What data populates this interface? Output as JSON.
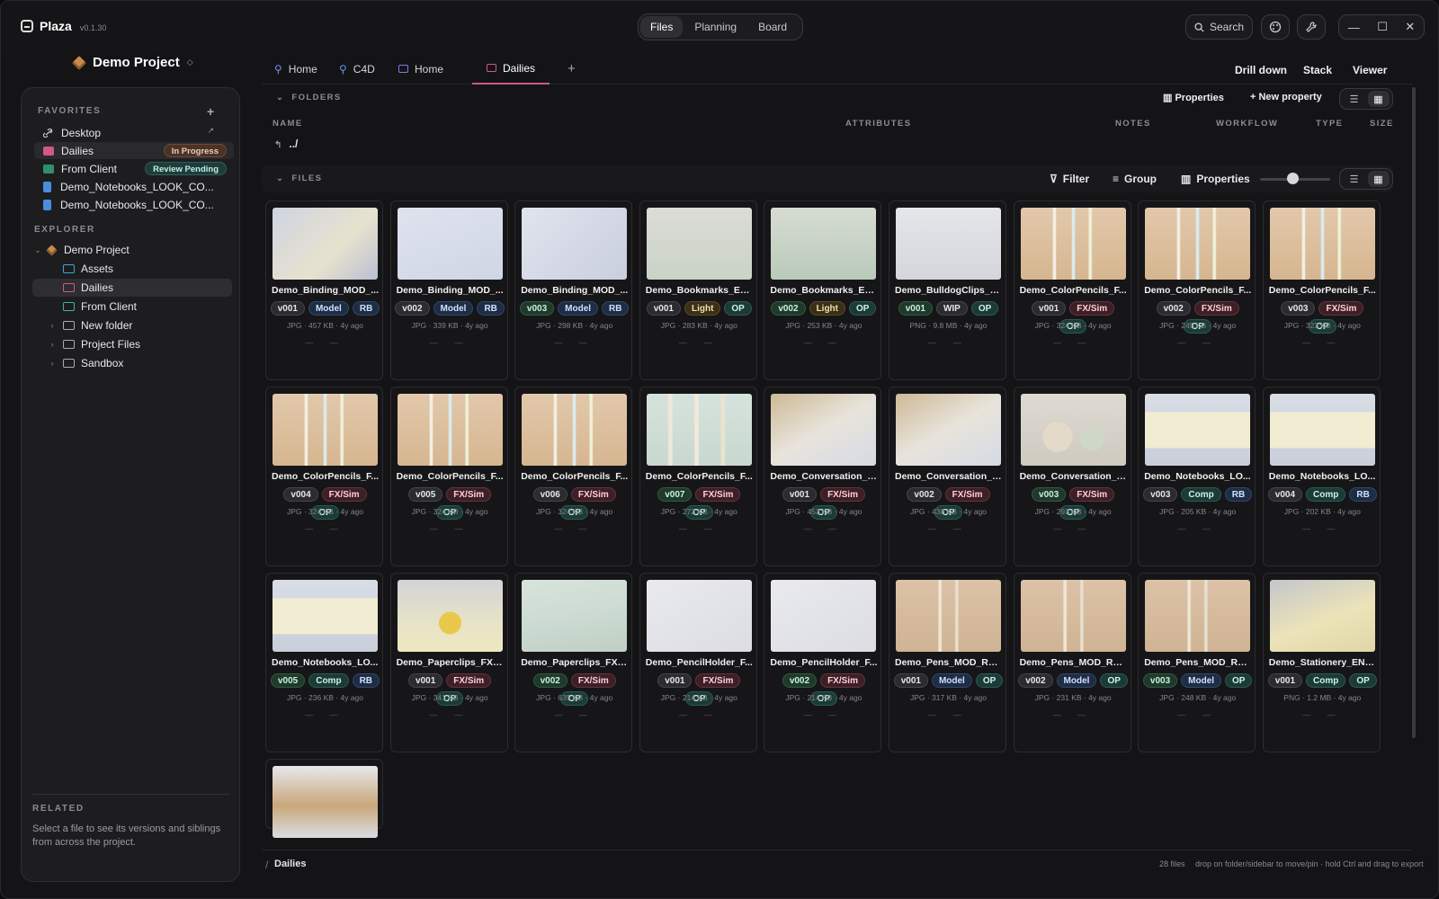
{
  "app": {
    "name": "Plaza",
    "version": "v0.1.30"
  },
  "top_nav": [
    "Files",
    "Planning",
    "Board"
  ],
  "top_nav_active": 0,
  "search_label": "Search",
  "window_controls": [
    "—",
    "☐",
    "✕"
  ],
  "project": {
    "title": "Demo Project",
    "caret": "◇"
  },
  "favorites": {
    "header": "FAVORITES",
    "add": "+",
    "items": [
      {
        "label": "Desktop",
        "badge": "",
        "link_arrow": "↗"
      },
      {
        "label": "Dailies",
        "badge": "In Progress"
      },
      {
        "label": "From Client",
        "badge": "Review Pending"
      },
      {
        "label": "Demo_Notebooks_LOOK_CO...",
        "badge": ""
      },
      {
        "label": "Demo_Notebooks_LOOK_CO...",
        "badge": ""
      }
    ]
  },
  "explorer": {
    "header": "EXPLORER",
    "items": [
      {
        "label": "Demo Project"
      },
      {
        "label": "Assets"
      },
      {
        "label": "Dailies"
      },
      {
        "label": "From Client"
      },
      {
        "label": "New folder"
      },
      {
        "label": "Project Files"
      },
      {
        "label": "Sandbox"
      }
    ]
  },
  "related": {
    "header": "RELATED",
    "text": "Select a file to see its versions and siblings from across the project."
  },
  "tabs": [
    {
      "label": "Home"
    },
    {
      "label": "C4D"
    },
    {
      "label": "Home"
    },
    {
      "label": "Dailies"
    }
  ],
  "tab_add": "+",
  "right_tools": [
    "Drill down",
    "Stack",
    "Viewer"
  ],
  "folders": {
    "header": "FOLDERS",
    "properties": "Properties",
    "new_property": "+ New property",
    "columns": [
      "NAME",
      "ATTRIBUTES",
      "NOTES",
      "WORKFLOW",
      "TYPE",
      "SIZE"
    ],
    "parent": "../"
  },
  "files": {
    "header": "FILES",
    "filter": "Filter",
    "group": "Group",
    "properties": "Properties"
  },
  "cards": [
    {
      "name": "Demo_Binding_MOD_...",
      "tags": [
        [
          "v001",
          "gray"
        ],
        [
          "Model",
          "blue"
        ],
        [
          "RB",
          "blue"
        ]
      ],
      "meta": "JPG · 457 KB · 4y ago",
      "dash": "— —"
    },
    {
      "name": "Demo_Binding_MOD_...",
      "tags": [
        [
          "v002",
          "gray"
        ],
        [
          "Model",
          "blue"
        ],
        [
          "RB",
          "blue"
        ]
      ],
      "meta": "JPG · 339 KB · 4y ago",
      "dash": "— —"
    },
    {
      "name": "Demo_Binding_MOD_...",
      "tags": [
        [
          "v003",
          "green"
        ],
        [
          "Model",
          "blue"
        ],
        [
          "RB",
          "blue"
        ]
      ],
      "meta": "JPG · 298 KB · 4y ago",
      "dash": "— —"
    },
    {
      "name": "Demo_Bookmarks_EN...",
      "tags": [
        [
          "v001",
          "gray"
        ],
        [
          "Light",
          "amber"
        ],
        [
          "OP",
          "teal"
        ]
      ],
      "meta": "JPG · 283 KB · 4y ago",
      "dash": "— —"
    },
    {
      "name": "Demo_Bookmarks_EN...",
      "tags": [
        [
          "v002",
          "green"
        ],
        [
          "Light",
          "amber"
        ],
        [
          "OP",
          "teal"
        ]
      ],
      "meta": "JPG · 253 KB · 4y ago",
      "dash": "— —"
    },
    {
      "name": "Demo_BulldogClips_L...",
      "tags": [
        [
          "v001",
          "green"
        ],
        [
          "WIP",
          "gray"
        ],
        [
          "OP",
          "teal"
        ]
      ],
      "meta": "PNG · 9.8 MB · 4y ago",
      "dash": "— —"
    },
    {
      "name": "Demo_ColorPencils_F...",
      "tags": [
        [
          "v001",
          "gray"
        ],
        [
          "FX/Sim",
          "red"
        ],
        [
          "OP",
          "teal"
        ]
      ],
      "meta": "JPG · 324 KB · 4y ago",
      "dash": "— —"
    },
    {
      "name": "Demo_ColorPencils_F...",
      "tags": [
        [
          "v002",
          "gray"
        ],
        [
          "FX/Sim",
          "red"
        ],
        [
          "OP",
          "teal"
        ]
      ],
      "meta": "JPG · 245 KB · 4y ago",
      "dash": "— —"
    },
    {
      "name": "Demo_ColorPencils_F...",
      "tags": [
        [
          "v003",
          "gray"
        ],
        [
          "FX/Sim",
          "red"
        ],
        [
          "OP",
          "teal"
        ]
      ],
      "meta": "JPG · 323 KB · 4y ago",
      "dash": "— —"
    },
    {
      "name": "Demo_ColorPencils_F...",
      "tags": [
        [
          "v004",
          "gray"
        ],
        [
          "FX/Sim",
          "red"
        ],
        [
          "OP",
          "teal"
        ]
      ],
      "meta": "JPG · 324 KB · 4y ago",
      "dash": "— —"
    },
    {
      "name": "Demo_ColorPencils_F...",
      "tags": [
        [
          "v005",
          "gray"
        ],
        [
          "FX/Sim",
          "red"
        ],
        [
          "OP",
          "teal"
        ]
      ],
      "meta": "JPG · 324 KB · 4y ago",
      "dash": "— —"
    },
    {
      "name": "Demo_ColorPencils_F...",
      "tags": [
        [
          "v006",
          "gray"
        ],
        [
          "FX/Sim",
          "red"
        ],
        [
          "OP",
          "teal"
        ]
      ],
      "meta": "JPG · 324 KB · 4y ago",
      "dash": "— —"
    },
    {
      "name": "Demo_ColorPencils_F...",
      "tags": [
        [
          "v007",
          "green"
        ],
        [
          "FX/Sim",
          "red"
        ],
        [
          "OP",
          "teal"
        ]
      ],
      "meta": "JPG · 272 KB · 4y ago",
      "dash": "— —"
    },
    {
      "name": "Demo_Conversation_F...",
      "tags": [
        [
          "v001",
          "gray"
        ],
        [
          "FX/Sim",
          "red"
        ],
        [
          "OP",
          "teal"
        ]
      ],
      "meta": "JPG · 453 KB · 4y ago",
      "dash": "— —"
    },
    {
      "name": "Demo_Conversation_F...",
      "tags": [
        [
          "v002",
          "gray"
        ],
        [
          "FX/Sim",
          "red"
        ],
        [
          "OP",
          "teal"
        ]
      ],
      "meta": "JPG · 438 KB · 4y ago",
      "dash": "— —"
    },
    {
      "name": "Demo_Conversation_F...",
      "tags": [
        [
          "v003",
          "green"
        ],
        [
          "FX/Sim",
          "red"
        ],
        [
          "OP",
          "teal"
        ]
      ],
      "meta": "JPG · 293 KB · 4y ago",
      "dash": "— —"
    },
    {
      "name": "Demo_Notebooks_LO...",
      "tags": [
        [
          "v003",
          "gray"
        ],
        [
          "Comp",
          "teal"
        ],
        [
          "RB",
          "blue"
        ]
      ],
      "meta": "JPG · 205 KB · 4y ago",
      "dash": "— —"
    },
    {
      "name": "Demo_Notebooks_LO...",
      "tags": [
        [
          "v004",
          "gray"
        ],
        [
          "Comp",
          "teal"
        ],
        [
          "RB",
          "blue"
        ]
      ],
      "meta": "JPG · 202 KB · 4y ago",
      "dash": "— —"
    },
    {
      "name": "Demo_Notebooks_LO...",
      "tags": [
        [
          "v005",
          "green"
        ],
        [
          "Comp",
          "teal"
        ],
        [
          "RB",
          "blue"
        ]
      ],
      "meta": "JPG · 236 KB · 4y ago",
      "dash": "— —"
    },
    {
      "name": "Demo_Paperclips_FX_...",
      "tags": [
        [
          "v001",
          "gray"
        ],
        [
          "FX/Sim",
          "red"
        ],
        [
          "OP",
          "teal"
        ]
      ],
      "meta": "JPG · 341 KB · 4y ago",
      "dash": "— —"
    },
    {
      "name": "Demo_Paperclips_FX_...",
      "tags": [
        [
          "v002",
          "green"
        ],
        [
          "FX/Sim",
          "red"
        ],
        [
          "OP",
          "teal"
        ]
      ],
      "meta": "JPG · 635 KB · 4y ago",
      "dash": "— —"
    },
    {
      "name": "Demo_PencilHolder_F...",
      "tags": [
        [
          "v001",
          "gray"
        ],
        [
          "FX/Sim",
          "red"
        ],
        [
          "OP",
          "teal"
        ]
      ],
      "meta": "JPG · 214 KB · 4y ago",
      "dash": "— —"
    },
    {
      "name": "Demo_PencilHolder_F...",
      "tags": [
        [
          "v002",
          "green"
        ],
        [
          "FX/Sim",
          "red"
        ],
        [
          "OP",
          "teal"
        ]
      ],
      "meta": "JPG · 214 KB · 4y ago",
      "dash": "— —"
    },
    {
      "name": "Demo_Pens_MOD_RN...",
      "tags": [
        [
          "v001",
          "gray"
        ],
        [
          "Model",
          "blue"
        ],
        [
          "OP",
          "teal"
        ]
      ],
      "meta": "JPG · 317 KB · 4y ago",
      "dash": "— —"
    },
    {
      "name": "Demo_Pens_MOD_RN...",
      "tags": [
        [
          "v002",
          "gray"
        ],
        [
          "Model",
          "blue"
        ],
        [
          "OP",
          "teal"
        ]
      ],
      "meta": "JPG · 231 KB · 4y ago",
      "dash": "— —"
    },
    {
      "name": "Demo_Pens_MOD_RN...",
      "tags": [
        [
          "v003",
          "green"
        ],
        [
          "Model",
          "blue"
        ],
        [
          "OP",
          "teal"
        ]
      ],
      "meta": "JPG · 248 KB · 4y ago",
      "dash": "— —"
    },
    {
      "name": "Demo_Stationery_ENV...",
      "tags": [
        [
          "v001",
          "gray"
        ],
        [
          "Comp",
          "teal"
        ],
        [
          "OP",
          "teal"
        ]
      ],
      "meta": "PNG · 1.2 MB · 4y ago",
      "dash": "— —"
    },
    {
      "name": "",
      "tags": [],
      "meta": "",
      "dash": ""
    }
  ],
  "footer": {
    "breadcrumb_sep": "/",
    "breadcrumb": "Dailies",
    "count": "28 files",
    "hint": "drop on folder/sidebar to move/pin · hold Ctrl and drag to export"
  },
  "colors": {
    "accent_tab": "#d05a80",
    "dailies_folder": "#d05a80",
    "client_folder": "#3fb58a",
    "assets_folder": "#3aa7d8"
  }
}
